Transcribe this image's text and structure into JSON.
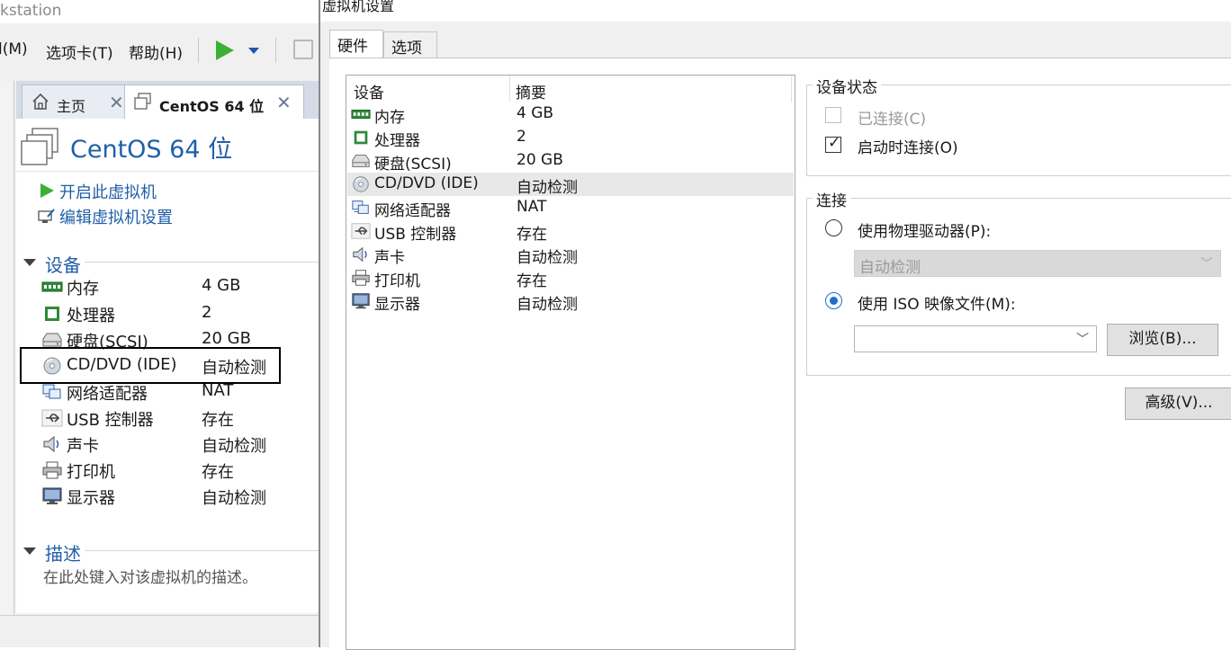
{
  "workstation": {
    "title_fragment": "kstation",
    "menu": [
      {
        "label": "l(M)"
      },
      {
        "label": "选项卡(T)"
      },
      {
        "label": "帮助(H)"
      }
    ],
    "tabs": [
      {
        "label": "主页",
        "icon": "home-icon"
      },
      {
        "label": "CentOS 64 位",
        "icon": "vm-icon"
      }
    ],
    "vm_name": "CentOS 64 位",
    "actions": [
      {
        "label": "开启此虚拟机",
        "icon": "play-icon"
      },
      {
        "label": "编辑虚拟机设置",
        "icon": "edit-settings-icon"
      }
    ],
    "devices_section": "设备",
    "devices": [
      {
        "name": "内存",
        "value": "4 GB",
        "icon": "memory-icon"
      },
      {
        "name": "处理器",
        "value": "2",
        "icon": "processor-icon"
      },
      {
        "name": "硬盘(SCSI)",
        "value": "20 GB",
        "icon": "hard-disk-icon"
      },
      {
        "name": "CD/DVD (IDE)",
        "value": "自动检测",
        "icon": "cd-dvd-icon"
      },
      {
        "name": "网络适配器",
        "value": "NAT",
        "icon": "network-adapter-icon"
      },
      {
        "name": "USB 控制器",
        "value": "存在",
        "icon": "usb-icon"
      },
      {
        "name": "声卡",
        "value": "自动检测",
        "icon": "sound-card-icon"
      },
      {
        "name": "打印机",
        "value": "存在",
        "icon": "printer-icon"
      },
      {
        "name": "显示器",
        "value": "自动检测",
        "icon": "display-icon"
      }
    ],
    "description_section": "描述",
    "description_placeholder": "在此处键入对该虚拟机的描述。"
  },
  "dialog": {
    "title": "虚拟机设置",
    "tabs": [
      "硬件",
      "选项"
    ],
    "list_headers": {
      "device": "设备",
      "summary": "摘要"
    },
    "hardware": [
      {
        "name": "内存",
        "value": "4 GB",
        "icon": "memory-icon"
      },
      {
        "name": "处理器",
        "value": "2",
        "icon": "processor-icon"
      },
      {
        "name": "硬盘(SCSI)",
        "value": "20 GB",
        "icon": "hard-disk-icon"
      },
      {
        "name": "CD/DVD (IDE)",
        "value": "自动检测",
        "icon": "cd-dvd-icon",
        "selected": true
      },
      {
        "name": "网络适配器",
        "value": "NAT",
        "icon": "network-adapter-icon"
      },
      {
        "name": "USB 控制器",
        "value": "存在",
        "icon": "usb-icon"
      },
      {
        "name": "声卡",
        "value": "自动检测",
        "icon": "sound-card-icon"
      },
      {
        "name": "打印机",
        "value": "存在",
        "icon": "printer-icon"
      },
      {
        "name": "显示器",
        "value": "自动检测",
        "icon": "display-icon"
      }
    ],
    "device_status": {
      "title": "设备状态",
      "connected": {
        "label": "已连接(C)",
        "checked": false,
        "disabled": true
      },
      "connect_at_power_on": {
        "label": "启动时连接(O)",
        "checked": true
      }
    },
    "connection": {
      "title": "连接",
      "physical_drive": {
        "label": "使用物理驱动器(P):",
        "selected": false
      },
      "physical_drive_value": "自动检测",
      "iso_image": {
        "label": "使用 ISO 映像文件(M):",
        "selected": true
      },
      "iso_path": "",
      "browse_label": "浏览(B)..."
    },
    "advanced_label": "高级(V)..."
  },
  "colors": {
    "accent_blue": "#1f5fa8",
    "play_green": "#3cb034",
    "radio_blue": "#1a6fd0"
  }
}
